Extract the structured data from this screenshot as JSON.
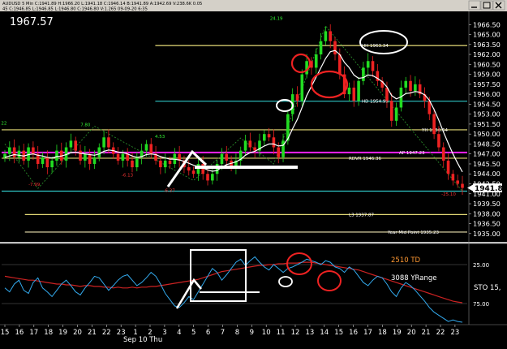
{
  "window": {
    "info_line1": "AUDUSD 5 Min  C:1941.89  H:1966.20  L:1941.18  C:1946.14  B:1941.89  A:1942.69  V:238.6K  0.05",
    "info_line2": "45  C:1946.85  L:1946.85  L:1946.80  C:1946.80  V:1.265  09-09-20  6:35"
  },
  "price_readout": "1967.57",
  "colors": {
    "background": "#000000",
    "bull": "#22dd22",
    "bear": "#ee2222",
    "line_white": "#ffffff",
    "level_yellow": "#e6dc78",
    "level_cyan": "#2ec4c4",
    "level_magenta": "#ee22ee",
    "level_pale": "#f0e6b4",
    "macd_red": "#cc2222",
    "osc_cyan": "#33aaee",
    "annotation_red": "#ee2222",
    "td_orange": "#ff9933"
  },
  "chart_data": {
    "type": "line",
    "price_panel": {
      "ylim": [
        1934,
        1968
      ],
      "tick_labels": [
        "1966.50",
        "1965.00",
        "1963.50",
        "1962.00",
        "1960.50",
        "1959.00",
        "1957.50",
        "1956.00",
        "1954.50",
        "1953.00",
        "1951.50",
        "1950.00",
        "1948.50",
        "1947.00",
        "1945.50",
        "1944.00",
        "1942.50",
        "1941.00",
        "1939.50",
        "1938.00",
        "1936.50",
        "1935.00"
      ],
      "tick_values": [
        1966.5,
        1965,
        1963.5,
        1962,
        1960.5,
        1959,
        1957.5,
        1956,
        1954.5,
        1953,
        1951.5,
        1950,
        1948.5,
        1947,
        1945.5,
        1944,
        1942.5,
        1941,
        1939.5,
        1938,
        1936.5,
        1935
      ],
      "last_price_label": "1941.89",
      "last_price": 1941.89,
      "close_series": [
        1947.0,
        1948.0,
        1946.5,
        1947.5,
        1946.0,
        1948.0,
        1947.0,
        1945.5,
        1946.5,
        1945.0,
        1946.0,
        1947.5,
        1946.0,
        1948.0,
        1949.0,
        1947.5,
        1946.0,
        1947.0,
        1945.5,
        1946.5,
        1948.0,
        1949.5,
        1948.0,
        1947.0,
        1946.0,
        1947.0,
        1946.0,
        1945.0,
        1946.5,
        1947.5,
        1948.5,
        1947.0,
        1946.0,
        1945.0,
        1946.0,
        1945.5,
        1947.0,
        1946.0,
        1945.0,
        1944.5,
        1944.0,
        1945.5,
        1944.0,
        1943.0,
        1944.0,
        1945.5,
        1947.0,
        1946.0,
        1945.0,
        1946.0,
        1947.5,
        1949.0,
        1948.0,
        1947.5,
        1949.0,
        1950.0,
        1949.5,
        1948.0,
        1946.5,
        1949.0,
        1953.0,
        1956.0,
        1955.0,
        1959.0,
        1961.0,
        1960.0,
        1962.0,
        1964.0,
        1965.5,
        1964.0,
        1962.0,
        1959.0,
        1956.0,
        1957.0,
        1955.0,
        1958.0,
        1960.0,
        1961.0,
        1959.5,
        1958.0,
        1957.0,
        1955.0,
        1952.0,
        1954.0,
        1957.0,
        1958.0,
        1956.5,
        1957.5,
        1956.0,
        1955.0,
        1953.0,
        1950.0,
        1948.0,
        1946.0,
        1944.0,
        1943.0,
        1942.5,
        1941.89
      ],
      "moving_average": [
        1946.5,
        1946.7,
        1946.9,
        1946.8,
        1946.7,
        1946.9,
        1947.0,
        1946.8,
        1946.7,
        1946.5,
        1946.4,
        1946.6,
        1946.7,
        1946.9,
        1947.2,
        1947.3,
        1947.1,
        1947.0,
        1946.9,
        1946.8,
        1947.0,
        1947.4,
        1947.6,
        1947.5,
        1947.3,
        1947.2,
        1947.0,
        1946.7,
        1946.5,
        1946.6,
        1946.9,
        1947.0,
        1946.9,
        1946.6,
        1946.4,
        1946.2,
        1946.2,
        1946.1,
        1945.9,
        1945.6,
        1945.3,
        1945.1,
        1944.9,
        1944.6,
        1944.4,
        1944.5,
        1945.0,
        1945.4,
        1945.6,
        1945.8,
        1946.2,
        1946.8,
        1947.2,
        1947.4,
        1947.8,
        1948.2,
        1948.5,
        1948.5,
        1948.2,
        1948.3,
        1949.3,
        1950.8,
        1952.2,
        1954.0,
        1955.8,
        1957.2,
        1958.6,
        1960.0,
        1961.4,
        1962.4,
        1962.6,
        1962.0,
        1960.8,
        1960.0,
        1958.9,
        1958.4,
        1958.5,
        1958.9,
        1958.8,
        1958.4,
        1957.9,
        1957.1,
        1955.8,
        1955.3,
        1955.6,
        1956.1,
        1956.2,
        1956.4,
        1956.3,
        1955.9,
        1955.1,
        1953.7,
        1952.1,
        1950.3,
        1948.6,
        1947.0,
        1945.6,
        1944.3
      ]
    },
    "levels": [
      {
        "name": "HH",
        "label": "HH  1963.34",
        "value": 1963.34,
        "color": "#e6dc78",
        "x_start": 0.33
      },
      {
        "name": "HD",
        "label": "HD  1954.95",
        "value": 1954.95,
        "color": "#2ec4c4",
        "x_start": 0.33
      },
      {
        "name": "YH",
        "label": "YH  1950.64",
        "value": 1950.64,
        "color": "#e6dc78",
        "x_start": 0
      },
      {
        "name": "AP",
        "label": "AP  1947.23",
        "value": 1947.23,
        "color": "#ee22ee",
        "x_start": 0
      },
      {
        "name": "RDVR",
        "label": "RDVR  1946.36",
        "value": 1946.36,
        "color": "#e6dc78",
        "x_start": 0
      },
      {
        "name": "LL",
        "label": "",
        "value": 1941.4,
        "color": "#2ec4c4",
        "x_start": 0
      },
      {
        "name": "L3",
        "label": "L3  1937.87",
        "value": 1937.87,
        "color": "#e6dc78",
        "x_start": 0.05
      },
      {
        "name": "YMP",
        "label": "Year Mid Point  1935.23",
        "value": 1935.23,
        "color": "#f0e6b4",
        "x_start": 0.05
      }
    ],
    "wave_labels": [
      {
        "text": "24.19",
        "color": "#33ee33",
        "price": 1967.2,
        "x": 0.59
      },
      {
        "text": "7.80",
        "color": "#33ee33",
        "price": 1951.2,
        "x": 0.18
      },
      {
        "text": "4.53",
        "color": "#33ee33",
        "price": 1949.4,
        "x": 0.34
      },
      {
        "text": "-6.13",
        "color": "#ee3333",
        "price": 1943.6,
        "x": 0.27
      },
      {
        "text": "-7.99",
        "color": "#ee3333",
        "price": 1942.2,
        "x": 0.07
      },
      {
        "text": "-6.37",
        "color": "#ee3333",
        "price": 1941.3,
        "x": 0.36
      },
      {
        "text": "-25.10",
        "color": "#ee3333",
        "price": 1940.7,
        "x": 0.96
      },
      {
        "text": "22",
        "color": "#33ee33",
        "price": 1951.4,
        "x": 0.005
      }
    ],
    "oscillator_panel": {
      "tick_labels": [
        "25.00",
        "75.00"
      ],
      "tick_values": [
        25,
        75
      ],
      "ylim": [
        0,
        100
      ],
      "stochastic": [
        55,
        60,
        50,
        45,
        58,
        62,
        48,
        42,
        55,
        60,
        66,
        58,
        50,
        45,
        52,
        60,
        64,
        55,
        48,
        40,
        42,
        50,
        58,
        52,
        45,
        40,
        38,
        45,
        52,
        48,
        42,
        35,
        40,
        50,
        62,
        70,
        78,
        80,
        74,
        66,
        70,
        60,
        50,
        40,
        30,
        35,
        45,
        38,
        30,
        22,
        18,
        26,
        20,
        15,
        22,
        28,
        32,
        25,
        30,
        35,
        30,
        28,
        25,
        22,
        18,
        20,
        22,
        25,
        20,
        22,
        28,
        30,
        35,
        28,
        32,
        40,
        48,
        52,
        45,
        40,
        42,
        50,
        60,
        66,
        55,
        48,
        52,
        58,
        65,
        72,
        80,
        86,
        90,
        94,
        98,
        96,
        98,
        99
      ],
      "signal_line": [
        40,
        41,
        42,
        43,
        44,
        45,
        45,
        46,
        47,
        48,
        49,
        50,
        50,
        51,
        51,
        52,
        53,
        52,
        52,
        53,
        53,
        54,
        54,
        55,
        54,
        55,
        55,
        54,
        55,
        54,
        54,
        53,
        53,
        52,
        51,
        50,
        49,
        48,
        47,
        46,
        45,
        44,
        42,
        40,
        38,
        36,
        34,
        33,
        32,
        31,
        30,
        29,
        28,
        27,
        26,
        26,
        25,
        25,
        24,
        24,
        23,
        23,
        23,
        22,
        22,
        22,
        23,
        24,
        25,
        26,
        27,
        28,
        29,
        30,
        31,
        32,
        34,
        36,
        38,
        40,
        42,
        44,
        46,
        48,
        50,
        52,
        54,
        56,
        58,
        60,
        62,
        64,
        66,
        68,
        70,
        72,
        73,
        74
      ]
    },
    "osc_labels": {
      "td": "2510 TD",
      "yrange": "3088 YRange",
      "sto": "STO  15,"
    },
    "x_axis": {
      "tick_labels": [
        "15",
        "16",
        "17",
        "18",
        "19",
        "20",
        "21",
        "22",
        "23",
        "Sep 10 Thu",
        "1",
        "2",
        "3",
        "4",
        "5",
        "6",
        "7",
        "8",
        "9",
        "10",
        "11",
        "12",
        "13",
        "14",
        "15",
        "16",
        "17",
        "18",
        "19",
        "20",
        "21",
        "22",
        "23"
      ],
      "date_label": "Sep 10 Thu"
    }
  }
}
